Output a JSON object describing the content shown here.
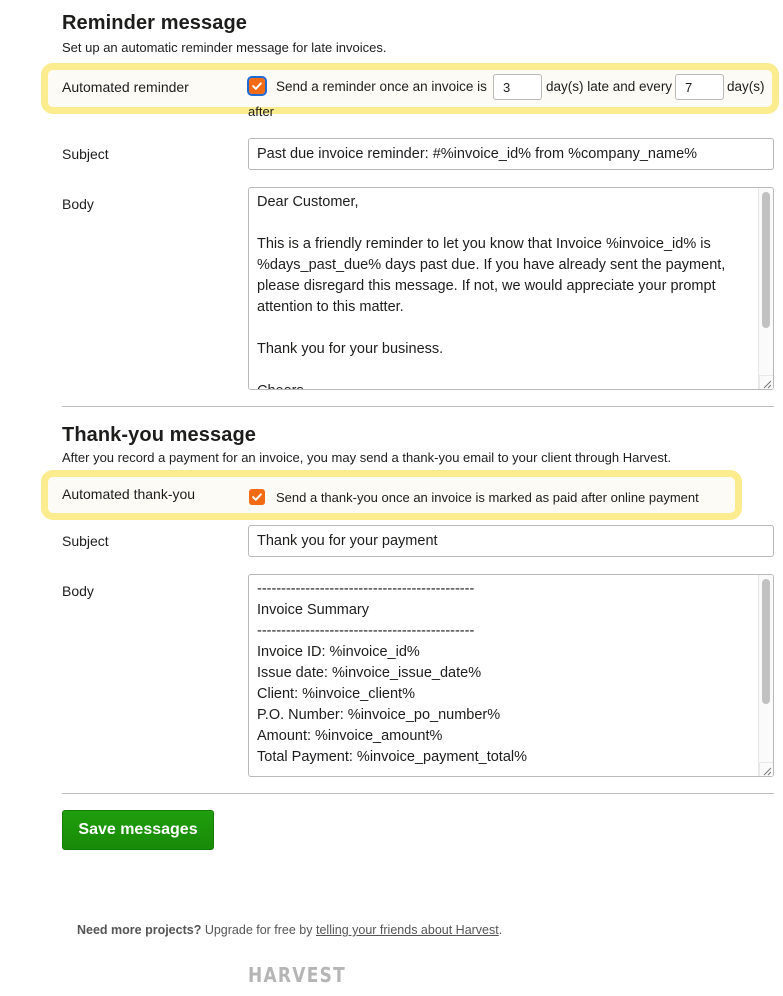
{
  "reminder": {
    "title": "Reminder message",
    "description": "Set up an automatic reminder message for late invoices.",
    "automated_label": "Automated reminder",
    "automated_checked": true,
    "text_before_first": "Send a reminder once an invoice is",
    "first_days_value": "3",
    "text_between": "day(s) late and every",
    "repeat_days_value": "7",
    "text_after_second": "day(s)",
    "text_wrap": "after",
    "subject_label": "Subject",
    "subject_value": "Past due invoice reminder: #%invoice_id% from %company_name%",
    "body_label": "Body",
    "body_value": "Dear Customer,\n\nThis is a friendly reminder to let you know that Invoice %invoice_id% is %days_past_due% days past due. If you have already sent the payment, please disregard this message. If not, we would appreciate your prompt attention to this matter.\n\nThank you for your business.\n\nCheers,"
  },
  "thank_you": {
    "title": "Thank-you message",
    "description": "After you record a payment for an invoice, you may send a thank-you email to your client through Harvest.",
    "automated_label": "Automated thank-you",
    "automated_checked": true,
    "checkbox_text": "Send a thank-you once an invoice is marked as paid after online payment",
    "subject_label": "Subject",
    "subject_value": "Thank you for your payment",
    "body_label": "Body",
    "body_value": "---------------------------------------------\nInvoice Summary\n---------------------------------------------\nInvoice ID: %invoice_id%\nIssue date: %invoice_issue_date%\nClient: %invoice_client%\nP.O. Number: %invoice_po_number%\nAmount: %invoice_amount%\nTotal Payment: %invoice_payment_total%"
  },
  "actions": {
    "save_label": "Save messages"
  },
  "footer": {
    "prompt_bold": "Need more projects?",
    "prompt_text": " Upgrade for free by ",
    "link_text": "telling your friends about Harvest",
    "trailing": ".",
    "logo_text": "HARVEST"
  },
  "colors": {
    "accent_orange": "#f36c15",
    "highlight_yellow": "#fbec8f",
    "save_green": "#1c960b"
  }
}
